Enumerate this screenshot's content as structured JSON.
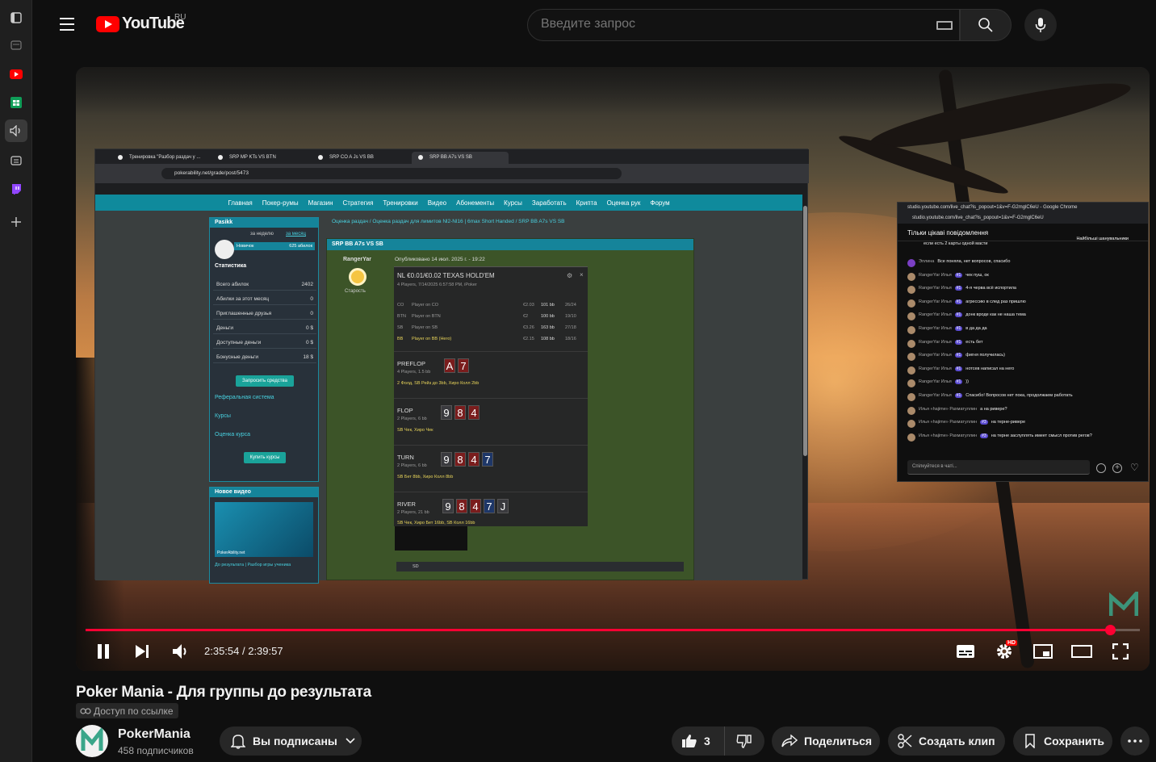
{
  "masthead": {
    "logo_text": "YouTube",
    "country": "RU",
    "search_placeholder": "Введите запрос"
  },
  "screen": {
    "tabs": [
      "Тренировка \"Разбор раздач у ...",
      "SRP MP KTs VS BTN",
      "SRP CO A Js VS BB",
      "SRP BB A7s VS SB"
    ],
    "url": "pokerability.net/grade/post/5473",
    "nav": [
      "Главная",
      "Покер-румы",
      "Магазин",
      "Стратегия",
      "Тренировки",
      "Видео",
      "Абонементы",
      "Курсы",
      "Заработать",
      "Крипта",
      "Оценка рук",
      "Форум"
    ],
    "user": {
      "name": "Pasikk",
      "week_label": "за неделю",
      "month_label": "за месяц",
      "rank": "Новичок",
      "points": "625 абилок",
      "stats_title": "Статистика",
      "rows": [
        {
          "label": "Всего абилок",
          "value": "2402"
        },
        {
          "label": "Абилки за этот месяц",
          "value": "0"
        },
        {
          "label": "Приглашенные друзья",
          "value": "0"
        },
        {
          "label": "Деньги",
          "value": "0 $"
        },
        {
          "label": "Доступные деньги",
          "value": "0 $"
        },
        {
          "label": "Бонусные деньги",
          "value": "18 $"
        }
      ],
      "withdraw_button": "Запросить средства",
      "referral_link": "Реферальная система",
      "courses_link": "Курсы",
      "rate_link": "Оценка курса",
      "buy_courses_button": "Купить курсы"
    },
    "new_video": {
      "title": "Новое видео",
      "brand": "PokerAbility.net",
      "caption": "До результата | Разбор игры ученика"
    },
    "breadcrumbs": "Оценка раздач / Оценка раздач для лимитов Nl2-Nl16 | 6max Short Handed / SRP BB A7s VS SB",
    "post": {
      "title": "SRP BB A7s VS SB",
      "author": "RangerYar",
      "author_role": "Старость",
      "published": "Опубликовано 14 июл. 2025 г. - 19:22",
      "game": "NL €0.01/€0.02 TEXAS HOLD'EM",
      "game_info": "4 Players, 7/14/2025 6:57:58 PM, iPoker",
      "positions": [
        {
          "pos": "CO",
          "player": "Player on CO",
          "stack": "€2.03",
          "bb": "101 bb",
          "stat": "26/24"
        },
        {
          "pos": "BTN",
          "player": "Player on BTN",
          "stack": "€2",
          "bb": "100 bb",
          "stat": "19/10"
        },
        {
          "pos": "SB",
          "player": "Player on SB",
          "stack": "€3.26",
          "bb": "163 bb",
          "stat": "27/18"
        },
        {
          "pos": "BB",
          "player": "Player on BB (Hero)",
          "stack": "€2.15",
          "bb": "108 bb",
          "stat": "18/16"
        }
      ],
      "streets": [
        {
          "name": "PREFLOP",
          "info": "4 Players, 1.5 bb",
          "action": "2 Фолд, SB Рейз до 3bb, Хиро Колл 2bb",
          "cards": [
            "A",
            "7"
          ]
        },
        {
          "name": "FLOP",
          "info": "2 Players, 6 bb",
          "action": "SB Чек, Хиро Чек",
          "cards": [
            "9",
            "8",
            "4"
          ]
        },
        {
          "name": "TURN",
          "info": "2 Players, 6 bb",
          "action": "SB Бет 8bb, Хиро Колл 8bb",
          "cards": [
            "9",
            "8",
            "4",
            "7"
          ]
        },
        {
          "name": "RIVER",
          "info": "2 Players, 21 bb",
          "action": "SB Чек, Хиро Бет 16bb, SB Колл 16bb",
          "cards": [
            "9",
            "8",
            "4",
            "7",
            "J"
          ]
        }
      ],
      "footer_tag": "SD"
    }
  },
  "chat": {
    "window_title": "studio.youtube.com/live_chat?is_popout=1&v=F-G2mglC6eU - Google Chrome",
    "url": "studio.youtube.com/live_chat?is_popout=1&v=F-G2mglC6eU",
    "mode": "Тільки цікаві повідомлення",
    "top_badge": "Найбільші шанувальники",
    "pinned": "если есть 2 карты одной масти",
    "messages": [
      {
        "name": "Эллина",
        "badge": "",
        "text": "Все поняла, нет вопросов, спасибо"
      },
      {
        "name": "RangerYar Илья",
        "badge": "#1",
        "text": "чек пуш, ок"
      },
      {
        "name": "RangerYar Илья",
        "badge": "#1",
        "text": "4-я черва всё испортила"
      },
      {
        "name": "RangerYar Илья",
        "badge": "#1",
        "text": "агрессию в след раз пришлю"
      },
      {
        "name": "RangerYar Илья",
        "badge": "#1",
        "text": "донк вроде как не наша тема"
      },
      {
        "name": "RangerYar Илья",
        "badge": "#1",
        "text": "в да да да"
      },
      {
        "name": "RangerYar Илья",
        "badge": "#1",
        "text": "есть бет"
      },
      {
        "name": "RangerYar Илья",
        "badge": "#1",
        "text": "фигня получилась)"
      },
      {
        "name": "RangerYar Илья",
        "badge": "#1",
        "text": "нотсев написал на него"
      },
      {
        "name": "RangerYar Илья",
        "badge": "#1",
        "text": "))"
      },
      {
        "name": "RangerYar Илья",
        "badge": "#1",
        "text": "Спасибо! Вопросов нет пока, продолжаем работать"
      },
      {
        "name": "Илья «hajime» Рахматуллин",
        "badge": "",
        "text": "а на ривере?"
      },
      {
        "name": "Илья «hajime» Рахматуллин",
        "badge": "#3",
        "text": "на терне-ривере"
      },
      {
        "name": "Илья «hajime» Рахматуллин",
        "badge": "#3",
        "text": "на терне заслуплять имеет смысл против регов?"
      }
    ],
    "input_placeholder": "Спілкуйтеся в чаті..."
  },
  "player": {
    "time": "2:35:54 / 2:39:57",
    "progress_fraction": 0.972,
    "hd_badge": "HD"
  },
  "video": {
    "title": "Poker Mania - Для группы до результата",
    "visibility": "Доступ по ссылке",
    "channel": "PokerMania",
    "subscribers": "458 подписчиков",
    "subscribed_label": "Вы подписаны",
    "likes": "3",
    "share_label": "Поделиться",
    "clip_label": "Создать клип",
    "save_label": "Сохранить"
  }
}
